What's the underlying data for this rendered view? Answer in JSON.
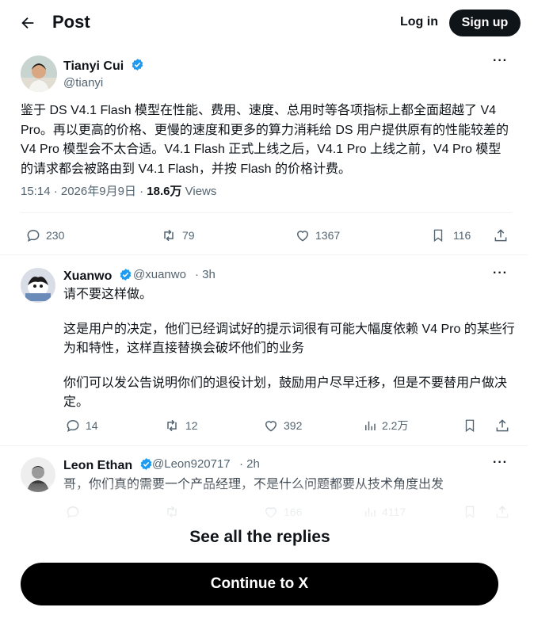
{
  "header": {
    "title": "Post",
    "login_label": "Log in",
    "signup_label": "Sign up"
  },
  "post": {
    "author_name": "Tianyi Cui",
    "handle": "@tianyi",
    "text": "鉴于 DS V4.1 Flash 模型在性能、费用、速度、总用时等各项指标上都全面超越了 V4 Pro。再以更高的价格、更慢的速度和更多的算力消耗给 DS 用户提供原有的性能较差的 V4 Pro 模型会不太合适。V4.1 Flash 正式上线之后，V4.1 Pro 上线之前，V4 Pro 模型的请求都会被路由到 V4.1 Flash，并按 Flash 的价格计费。",
    "time": "15:14 · 2026年9月9日 · ",
    "views_count": "18.6万",
    "views_label": " Views",
    "replies": "230",
    "reposts": "79",
    "likes": "1367",
    "bookmarks": "116"
  },
  "replies": [
    {
      "name": "Xuanwo",
      "handle": "@xuanwo",
      "time": "· 3h",
      "paragraphs": [
        "请不要这样做。",
        "这是用户的决定，他们已经调试好的提示词很有可能大幅度依赖 V4 Pro 的某些行为和特性，这样直接替换会破坏他们的业务",
        "你们可以发公告说明你们的退役计划，鼓励用户尽早迁移，但是不要替用户做决定。"
      ],
      "replies": "14",
      "reposts": "12",
      "likes": "392",
      "views": "2.2万"
    },
    {
      "name": "Leon Ethan",
      "handle": "@Leon920717",
      "time": "· 2h",
      "paragraphs": [
        "哥，你们真的需要一个产品经理，不是什么问题都要从技术角度出发"
      ],
      "replies": "",
      "reposts": "",
      "likes": "166",
      "views": "4117"
    }
  ],
  "footer": {
    "see_all": "See all the replies",
    "continue": "Continue to X"
  },
  "colors": {
    "verified": "#1d9bf0",
    "text": "#0f1419",
    "muted": "#536471"
  }
}
